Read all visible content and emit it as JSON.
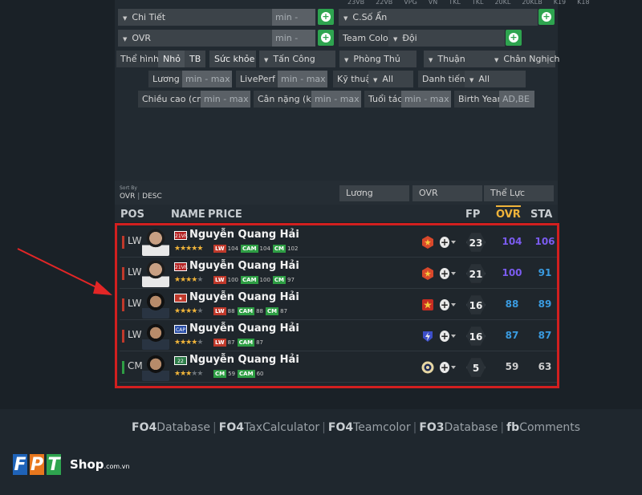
{
  "top_tiny": [
    "23VB",
    "22VB",
    "VPG",
    "VN",
    "TKL",
    "TKL",
    "20KL",
    "20KLB",
    "K19",
    "K18"
  ],
  "filters": {
    "chi_tiet": "Chi Tiết",
    "c_so_an": "C.Số Ẩn",
    "ovr": "OVR",
    "minmax_1": "min -max",
    "minmax_2": "min -max",
    "team_color_label": "Team Color",
    "doi": "Đội",
    "the_hinh": "Thể hình",
    "nho": "Nhỏ",
    "tb": "TB",
    "suc_khoe": "Sức khỏe",
    "tan_cong": "Tấn Công",
    "phong_thu": "Phòng Thủ",
    "thuan": "Thuận",
    "chan_nghich": "Chân Nghịch",
    "luong": "Lương",
    "min_max": "min - max",
    "liveperf": "LivePerf",
    "ky_thuat": "Kỹ thuật",
    "all": "All",
    "danh_tieng": "Danh tiếng",
    "chieu_cao": "Chiều cao (cm)",
    "can_nang": "Cân nặng (kg)",
    "tuoi_tac": "Tuổi tác",
    "birth_year": "Birth Year",
    "birth_year_placeholder": "AD,BE"
  },
  "sort": {
    "label": "Sort By",
    "value_left": "OVR",
    "value_sep": "|",
    "value_right": "DESC",
    "buttons": [
      "Lương",
      "OVR",
      "Thể Lực"
    ]
  },
  "table_header": {
    "pos": "POS",
    "name": "NAME",
    "price": "PRICE",
    "fp": "FP",
    "ovr": "OVR",
    "sta": "STA"
  },
  "players": [
    {
      "pos": "LW",
      "pos_color": "#c0392b",
      "season": "21VR",
      "season_color": "#b32020",
      "name": "Nguyễn Quang Hải",
      "stars": 5,
      "badges": [
        [
          "LW",
          "104",
          "#c0392b"
        ],
        [
          "CAM",
          "104",
          "#2e9e44"
        ],
        [
          "CM",
          "102",
          "#2e9e44"
        ]
      ],
      "team_icon": "vietnam-team",
      "fp": "23",
      "ovr": "104",
      "sta": "106",
      "ovr_color": "#7b5cf0",
      "sta_color": "#7b5cf0",
      "face": "light"
    },
    {
      "pos": "LW",
      "pos_color": "#c0392b",
      "season": "21VR",
      "season_color": "#b32020",
      "name": "Nguyễn Quang Hải",
      "stars": 4,
      "badges": [
        [
          "LW",
          "100",
          "#c0392b"
        ],
        [
          "CAM",
          "100",
          "#2e9e44"
        ],
        [
          "CM",
          "97",
          "#2e9e44"
        ]
      ],
      "team_icon": "vietnam-team",
      "fp": "21",
      "ovr": "100",
      "sta": "91",
      "ovr_color": "#7b5cf0",
      "sta_color": "#3a9be0",
      "face": "light"
    },
    {
      "pos": "LW",
      "pos_color": "#c0392b",
      "season": "★",
      "season_color": "#c0392b",
      "name": "Nguyễn Quang Hải",
      "stars": 4,
      "badges": [
        [
          "LW",
          "88",
          "#c0392b"
        ],
        [
          "CAM",
          "88",
          "#2e9e44"
        ],
        [
          "CM",
          "87",
          "#2e9e44"
        ]
      ],
      "team_icon": "vietnam-star",
      "fp": "16",
      "ovr": "88",
      "sta": "89",
      "ovr_color": "#3a9be0",
      "sta_color": "#3a9be0",
      "face": "dark"
    },
    {
      "pos": "LW",
      "pos_color": "#c0392b",
      "season": "CAP",
      "season_color": "#2a4fa8",
      "name": "Nguyễn Quang Hải",
      "stars": 4,
      "badges": [
        [
          "LW",
          "87",
          "#c0392b"
        ],
        [
          "CAM",
          "87",
          "#2e9e44"
        ]
      ],
      "team_icon": "club-bolt",
      "fp": "16",
      "ovr": "87",
      "sta": "87",
      "ovr_color": "#3a9be0",
      "sta_color": "#3a9be0",
      "face": "dark"
    },
    {
      "pos": "CM",
      "pos_color": "#2e9e44",
      "season": "22",
      "season_color": "#2e7d4a",
      "name": "Nguyễn Quang Hải",
      "stars": 3,
      "badges": [
        [
          "CM",
          "59",
          "#2e9e44"
        ],
        [
          "CAM",
          "60",
          "#2e9e44"
        ]
      ],
      "team_icon": "club-round",
      "fp": "5",
      "ovr": "59",
      "sta": "63",
      "ovr_color": "#cfcfcf",
      "sta_color": "#cfcfcf",
      "face": "dark"
    }
  ],
  "footer_links": [
    [
      "FO4",
      "Database"
    ],
    [
      "FO4",
      "TaxCalculator"
    ],
    [
      "FO4",
      "Teamcolor"
    ],
    [
      "FO3",
      "Database"
    ],
    [
      "fb",
      "Comments"
    ]
  ],
  "logo": {
    "letters": [
      "F",
      "P",
      "T"
    ],
    "shop": "Shop",
    "domain": ".com.vn",
    "colors": [
      "#1f63b8",
      "#e8771e",
      "#2ea44f"
    ]
  },
  "accent": {
    "green": "#2ea44f",
    "highlight_border": "#d21f1f",
    "ovr_header": "#f0b43a"
  }
}
